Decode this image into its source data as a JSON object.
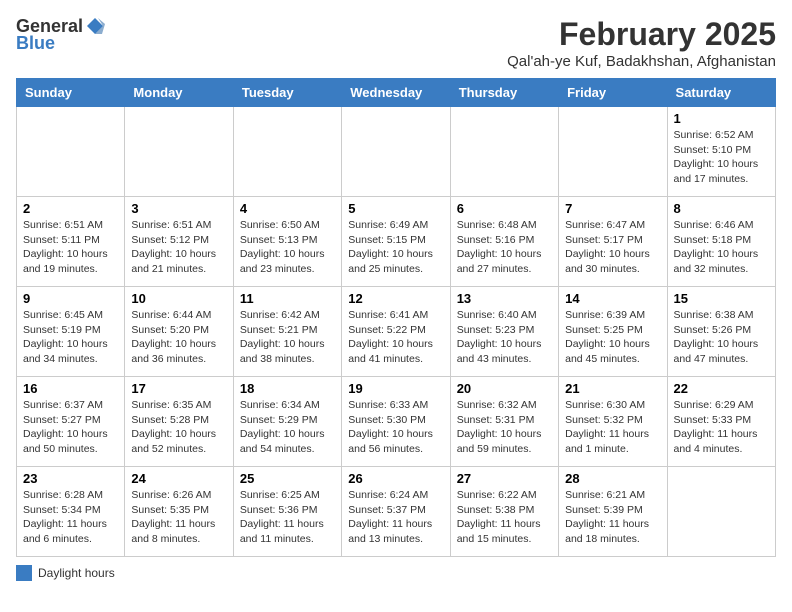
{
  "logo": {
    "general": "General",
    "blue": "Blue"
  },
  "title": {
    "month": "February 2025",
    "location": "Qal'ah-ye Kuf, Badakhshan, Afghanistan"
  },
  "weekdays": [
    "Sunday",
    "Monday",
    "Tuesday",
    "Wednesday",
    "Thursday",
    "Friday",
    "Saturday"
  ],
  "weeks": [
    [
      {
        "day": "",
        "info": ""
      },
      {
        "day": "",
        "info": ""
      },
      {
        "day": "",
        "info": ""
      },
      {
        "day": "",
        "info": ""
      },
      {
        "day": "",
        "info": ""
      },
      {
        "day": "",
        "info": ""
      },
      {
        "day": "1",
        "info": "Sunrise: 6:52 AM\nSunset: 5:10 PM\nDaylight: 10 hours and 17 minutes."
      }
    ],
    [
      {
        "day": "2",
        "info": "Sunrise: 6:51 AM\nSunset: 5:11 PM\nDaylight: 10 hours and 19 minutes."
      },
      {
        "day": "3",
        "info": "Sunrise: 6:51 AM\nSunset: 5:12 PM\nDaylight: 10 hours and 21 minutes."
      },
      {
        "day": "4",
        "info": "Sunrise: 6:50 AM\nSunset: 5:13 PM\nDaylight: 10 hours and 23 minutes."
      },
      {
        "day": "5",
        "info": "Sunrise: 6:49 AM\nSunset: 5:15 PM\nDaylight: 10 hours and 25 minutes."
      },
      {
        "day": "6",
        "info": "Sunrise: 6:48 AM\nSunset: 5:16 PM\nDaylight: 10 hours and 27 minutes."
      },
      {
        "day": "7",
        "info": "Sunrise: 6:47 AM\nSunset: 5:17 PM\nDaylight: 10 hours and 30 minutes."
      },
      {
        "day": "8",
        "info": "Sunrise: 6:46 AM\nSunset: 5:18 PM\nDaylight: 10 hours and 32 minutes."
      }
    ],
    [
      {
        "day": "9",
        "info": "Sunrise: 6:45 AM\nSunset: 5:19 PM\nDaylight: 10 hours and 34 minutes."
      },
      {
        "day": "10",
        "info": "Sunrise: 6:44 AM\nSunset: 5:20 PM\nDaylight: 10 hours and 36 minutes."
      },
      {
        "day": "11",
        "info": "Sunrise: 6:42 AM\nSunset: 5:21 PM\nDaylight: 10 hours and 38 minutes."
      },
      {
        "day": "12",
        "info": "Sunrise: 6:41 AM\nSunset: 5:22 PM\nDaylight: 10 hours and 41 minutes."
      },
      {
        "day": "13",
        "info": "Sunrise: 6:40 AM\nSunset: 5:23 PM\nDaylight: 10 hours and 43 minutes."
      },
      {
        "day": "14",
        "info": "Sunrise: 6:39 AM\nSunset: 5:25 PM\nDaylight: 10 hours and 45 minutes."
      },
      {
        "day": "15",
        "info": "Sunrise: 6:38 AM\nSunset: 5:26 PM\nDaylight: 10 hours and 47 minutes."
      }
    ],
    [
      {
        "day": "16",
        "info": "Sunrise: 6:37 AM\nSunset: 5:27 PM\nDaylight: 10 hours and 50 minutes."
      },
      {
        "day": "17",
        "info": "Sunrise: 6:35 AM\nSunset: 5:28 PM\nDaylight: 10 hours and 52 minutes."
      },
      {
        "day": "18",
        "info": "Sunrise: 6:34 AM\nSunset: 5:29 PM\nDaylight: 10 hours and 54 minutes."
      },
      {
        "day": "19",
        "info": "Sunrise: 6:33 AM\nSunset: 5:30 PM\nDaylight: 10 hours and 56 minutes."
      },
      {
        "day": "20",
        "info": "Sunrise: 6:32 AM\nSunset: 5:31 PM\nDaylight: 10 hours and 59 minutes."
      },
      {
        "day": "21",
        "info": "Sunrise: 6:30 AM\nSunset: 5:32 PM\nDaylight: 11 hours and 1 minute."
      },
      {
        "day": "22",
        "info": "Sunrise: 6:29 AM\nSunset: 5:33 PM\nDaylight: 11 hours and 4 minutes."
      }
    ],
    [
      {
        "day": "23",
        "info": "Sunrise: 6:28 AM\nSunset: 5:34 PM\nDaylight: 11 hours and 6 minutes."
      },
      {
        "day": "24",
        "info": "Sunrise: 6:26 AM\nSunset: 5:35 PM\nDaylight: 11 hours and 8 minutes."
      },
      {
        "day": "25",
        "info": "Sunrise: 6:25 AM\nSunset: 5:36 PM\nDaylight: 11 hours and 11 minutes."
      },
      {
        "day": "26",
        "info": "Sunrise: 6:24 AM\nSunset: 5:37 PM\nDaylight: 11 hours and 13 minutes."
      },
      {
        "day": "27",
        "info": "Sunrise: 6:22 AM\nSunset: 5:38 PM\nDaylight: 11 hours and 15 minutes."
      },
      {
        "day": "28",
        "info": "Sunrise: 6:21 AM\nSunset: 5:39 PM\nDaylight: 11 hours and 18 minutes."
      },
      {
        "day": "",
        "info": ""
      }
    ]
  ],
  "legend": {
    "label": "Daylight hours"
  }
}
